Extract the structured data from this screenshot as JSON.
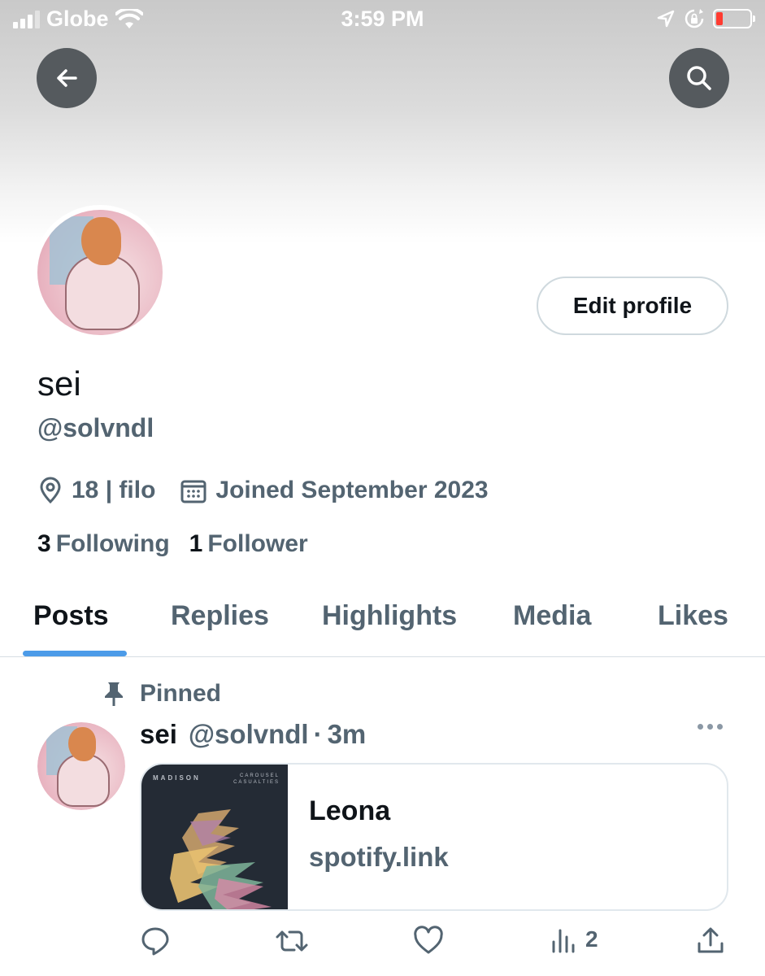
{
  "status_bar": {
    "carrier": "Globe",
    "time": "3:59 PM"
  },
  "header": {
    "back_icon": "arrow-left-icon",
    "search_icon": "search-icon"
  },
  "profile": {
    "display_name": "sei",
    "handle": "@solvndl",
    "edit_button_label": "Edit profile",
    "location": "18 | filo",
    "joined": "Joined September 2023",
    "following_count": "3",
    "following_label": "Following",
    "followers_count": "1",
    "followers_label": "Follower"
  },
  "tabs": [
    {
      "label": "Posts",
      "active": true
    },
    {
      "label": "Replies",
      "active": false
    },
    {
      "label": "Highlights",
      "active": false
    },
    {
      "label": "Media",
      "active": false
    },
    {
      "label": "Likes",
      "active": false
    }
  ],
  "pinned_post": {
    "pinned_label": "Pinned",
    "author_name": "sei",
    "author_handle": "@solvndl",
    "separator": "·",
    "time_ago": "3m",
    "link_card": {
      "album_artist": "MADISON",
      "album_title_line1": "CAROUSEL",
      "album_title_line2": "CASUALTIES",
      "title": "Leona",
      "domain": "spotify.link"
    },
    "actions": {
      "reply_icon": "reply-icon",
      "repost_icon": "repost-icon",
      "like_icon": "heart-icon",
      "views_icon": "views-icon",
      "views_count": "2",
      "share_icon": "share-icon"
    }
  },
  "colors": {
    "text_primary": "#0f1419",
    "text_secondary": "#536471",
    "accent": "#4c9be8",
    "border": "#cfd9de",
    "battery_low": "#ff3b30"
  }
}
